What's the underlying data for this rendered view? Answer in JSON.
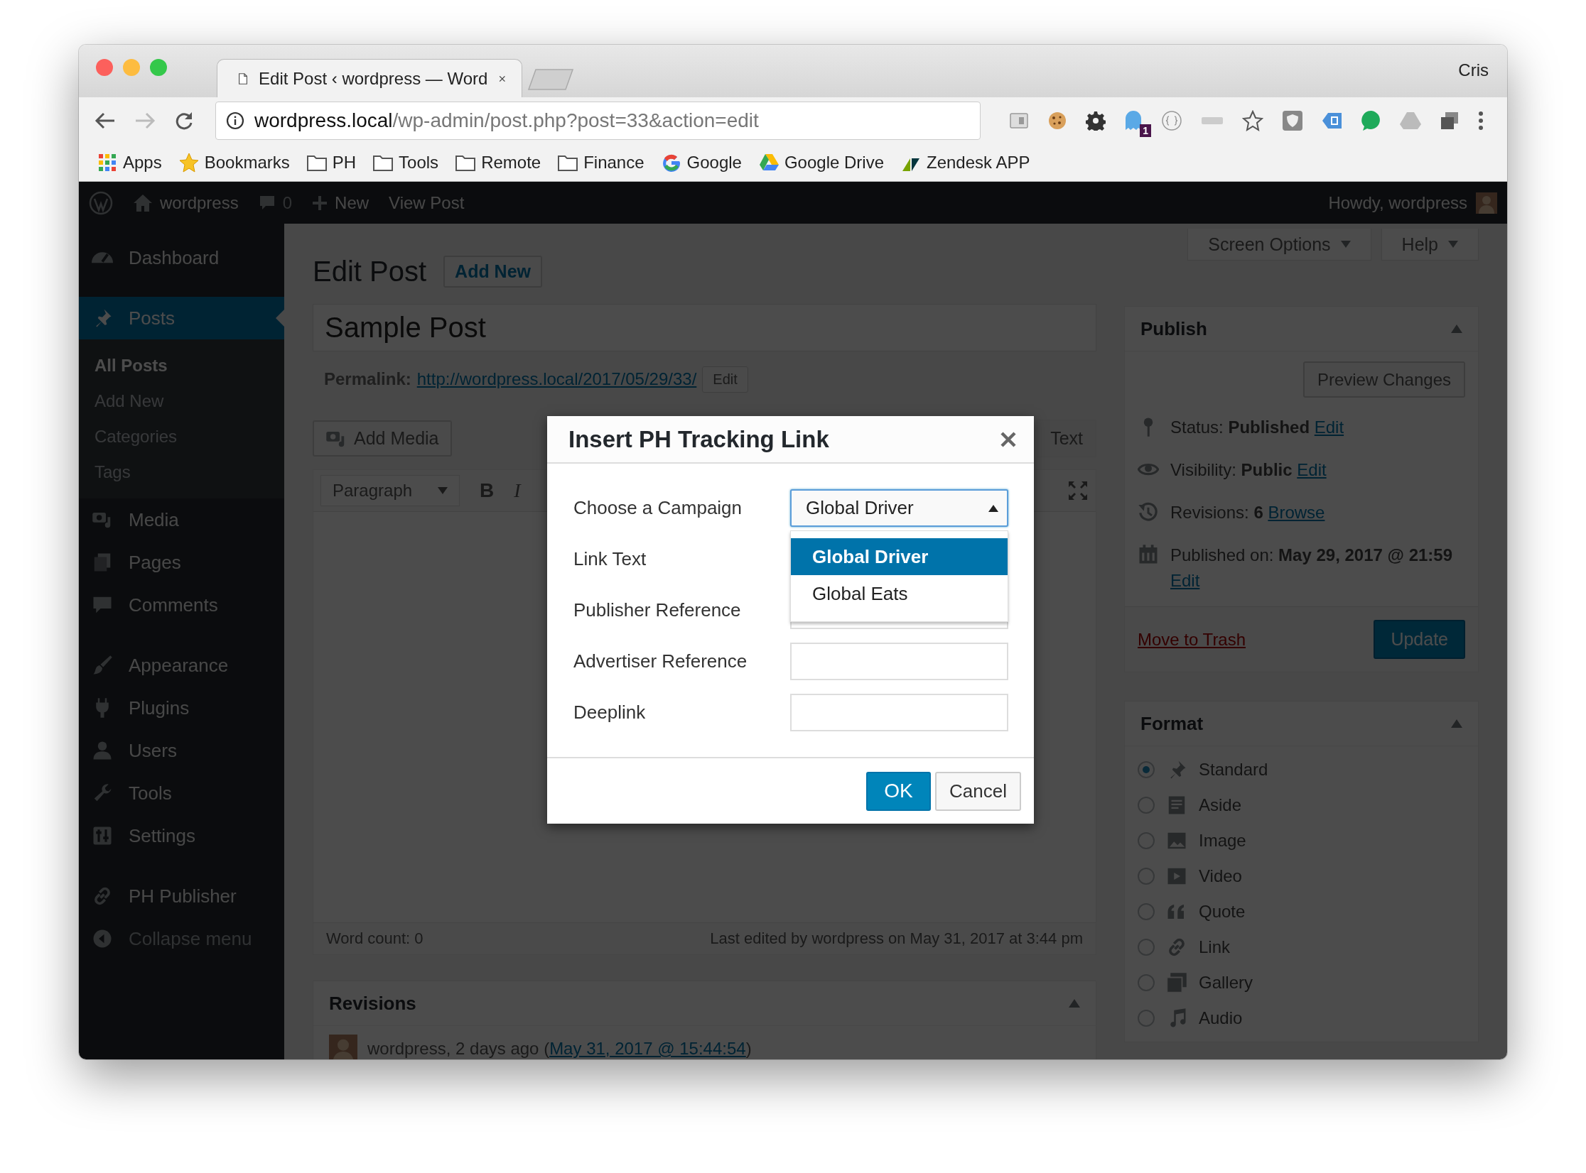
{
  "browser": {
    "tab_title": "Edit Post ‹ wordpress — Word",
    "profile": "Cris",
    "url_host": "wordpress.local",
    "url_path": "/wp-admin/post.php?post=33&action=edit",
    "extension_badge": "1",
    "bookmarks": [
      {
        "label": "Apps"
      },
      {
        "label": "Bookmarks"
      },
      {
        "label": "PH"
      },
      {
        "label": "Tools"
      },
      {
        "label": "Remote"
      },
      {
        "label": "Finance"
      },
      {
        "label": "Google"
      },
      {
        "label": "Google Drive"
      },
      {
        "label": "Zendesk APP"
      }
    ]
  },
  "admin_bar": {
    "site": "wordpress",
    "comments": "0",
    "new": "New",
    "view": "View Post",
    "howdy": "Howdy, wordpress"
  },
  "sidebar": {
    "groups": [
      [
        {
          "label": "Dashboard",
          "selected": false
        }
      ],
      [
        {
          "label": "Posts",
          "selected": true,
          "children": [
            {
              "label": "All Posts",
              "selected": true
            },
            {
              "label": "Add New",
              "selected": false
            },
            {
              "label": "Categories",
              "selected": false
            },
            {
              "label": "Tags",
              "selected": false
            }
          ]
        },
        {
          "label": "Media",
          "selected": false
        },
        {
          "label": "Pages",
          "selected": false
        },
        {
          "label": "Comments",
          "selected": false
        }
      ],
      [
        {
          "label": "Appearance",
          "selected": false
        },
        {
          "label": "Plugins",
          "selected": false
        },
        {
          "label": "Users",
          "selected": false
        },
        {
          "label": "Tools",
          "selected": false
        },
        {
          "label": "Settings",
          "selected": false
        }
      ],
      [
        {
          "label": "PH Publisher",
          "selected": false
        }
      ]
    ],
    "collapse": "Collapse menu"
  },
  "screen_tabs": [
    "Screen Options",
    "Help"
  ],
  "heading": "Edit Post",
  "add_new": "Add New",
  "post_title": "Sample Post",
  "permalink": {
    "label": "Permalink:",
    "url": "http://wordpress.local/2017/05/29/33/",
    "edit": "Edit"
  },
  "editor": {
    "add_media": "Add Media",
    "format": "Paragraph",
    "bold": "B",
    "italic": "I",
    "text_tab": "Text",
    "word_count": "Word count: 0",
    "last_edited": "Last edited by wordpress on May 31, 2017 at 3:44 pm"
  },
  "revisions": {
    "title": "Revisions",
    "entry": "wordpress, 2 days ago (",
    "entry_link": "May 31, 2017 @ 15:44:54",
    "entry_end": ")"
  },
  "publish": {
    "title": "Publish",
    "preview": "Preview Changes",
    "rows": [
      {
        "text": "Status: **Published**",
        "link": "Edit"
      },
      {
        "text": "Visibility: **Public**",
        "link": "Edit"
      },
      {
        "text": "Revisions: **6**",
        "link": "Browse"
      },
      {
        "text": "Published on: **May 29, 2017 @ 21:59**",
        "link": "Edit"
      }
    ],
    "trash": "Move to Trash",
    "update": "Update"
  },
  "format": {
    "title": "Format",
    "options": [
      {
        "label": "Standard",
        "selected": true
      },
      {
        "label": "Aside",
        "selected": false
      },
      {
        "label": "Image",
        "selected": false
      },
      {
        "label": "Video",
        "selected": false
      },
      {
        "label": "Quote",
        "selected": false
      },
      {
        "label": "Link",
        "selected": false
      },
      {
        "label": "Gallery",
        "selected": false
      },
      {
        "label": "Audio",
        "selected": false
      }
    ]
  },
  "dialog": {
    "title": "Insert PH Tracking Link",
    "fields": [
      {
        "label": "Choose a Campaign",
        "kind": "select",
        "value": "Global Driver",
        "expanded": true,
        "options": [
          {
            "label": "Global Driver",
            "selected": true
          },
          {
            "label": "Global Eats",
            "selected": false
          }
        ]
      },
      {
        "label": "Link Text",
        "kind": "text"
      },
      {
        "label": "Publisher Reference",
        "kind": "text"
      },
      {
        "label": "Advertiser Reference",
        "kind": "text"
      },
      {
        "label": "Deeplink",
        "kind": "text"
      }
    ],
    "buttons": [
      {
        "label": "OK",
        "kind": "primary"
      },
      {
        "label": "Cancel",
        "kind": "secondary"
      }
    ]
  }
}
